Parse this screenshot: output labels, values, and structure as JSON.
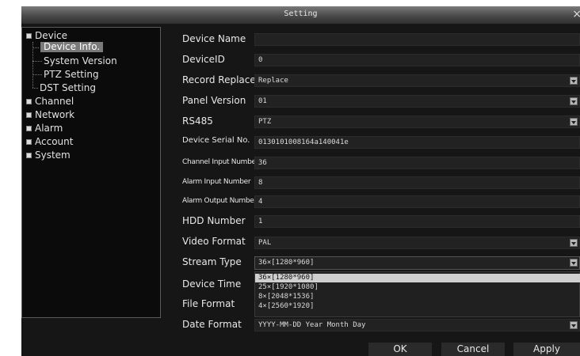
{
  "window": {
    "title": "Setting",
    "close": "×"
  },
  "tree": {
    "items": [
      "Device",
      "Device Info.",
      "System Version",
      "PTZ Setting",
      "DST Setting",
      "Channel",
      "Network",
      "Alarm",
      "Account",
      "System"
    ]
  },
  "fields": {
    "device_name": {
      "label": "Device Name",
      "value": ""
    },
    "device_id": {
      "label": "DeviceID",
      "value": "0"
    },
    "record_replace": {
      "label": "Record Replace",
      "value": "Replace"
    },
    "panel_version": {
      "label": "Panel Version",
      "value": "01"
    },
    "rs485": {
      "label": "RS485",
      "value": "PTZ"
    },
    "serial": {
      "label": "Device Serial No.",
      "value": "0130101008164a140041e"
    },
    "channel_input": {
      "label": "Channel Input Number",
      "value": "36"
    },
    "alarm_input": {
      "label": "Alarm Input Number",
      "value": "8"
    },
    "alarm_output": {
      "label": "Alarm Output Number",
      "value": "4"
    },
    "hdd": {
      "label": "HDD Number",
      "value": "1"
    },
    "video_format": {
      "label": "Video Format",
      "value": "PAL"
    },
    "stream_type": {
      "label": "Stream Type",
      "value": "36×[1280*960]"
    },
    "device_time": {
      "label": "Device Time"
    },
    "file_format": {
      "label": "File Format"
    },
    "date_format": {
      "label": "Date Format",
      "value": "YYYY-MM-DD Year Month Day"
    }
  },
  "stream_options": [
    "36×[1280*960]",
    "25×[1920*1080]",
    "8×[2048*1536]",
    "4×[2560*1920]"
  ],
  "buttons": {
    "ok": "OK",
    "cancel": "Cancel",
    "apply": "Apply"
  }
}
